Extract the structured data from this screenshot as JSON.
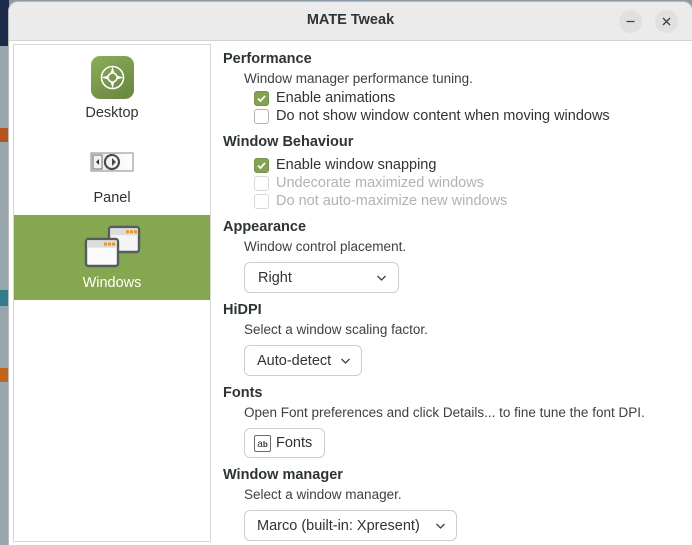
{
  "window": {
    "title": "MATE Tweak",
    "controls": {
      "minimize_label": "–",
      "close_label": "×"
    }
  },
  "sidebar": {
    "items": [
      {
        "label": "Desktop",
        "icon": "desktop-compass-icon",
        "selected": false
      },
      {
        "label": "Panel",
        "icon": "panel-icon",
        "selected": false
      },
      {
        "label": "Windows",
        "icon": "windows-stack-icon",
        "selected": true
      }
    ]
  },
  "sections": {
    "performance": {
      "title": "Performance",
      "description": "Window manager performance tuning.",
      "checkboxes": [
        {
          "label": "Enable animations",
          "checked": true,
          "enabled": true
        },
        {
          "label": "Do not show window content when moving windows",
          "checked": false,
          "enabled": true
        }
      ]
    },
    "window_behaviour": {
      "title": "Window Behaviour",
      "checkboxes": [
        {
          "label": "Enable window snapping",
          "checked": true,
          "enabled": true
        },
        {
          "label": "Undecorate maximized windows",
          "checked": false,
          "enabled": false
        },
        {
          "label": "Do not auto-maximize new windows",
          "checked": false,
          "enabled": false
        }
      ]
    },
    "appearance": {
      "title": "Appearance",
      "description": "Window control placement.",
      "placement_value": "Right"
    },
    "hidpi": {
      "title": "HiDPI",
      "description": "Select a window scaling factor.",
      "scaling_value": "Auto-detect"
    },
    "fonts": {
      "title": "Fonts",
      "description": "Open Font preferences and click Details... to fine tune the font DPI.",
      "button_label": "Fonts",
      "button_icon": "font-ab-icon"
    },
    "window_manager": {
      "title": "Window manager",
      "description": "Select a window manager.",
      "wm_value": "Marco (built-in: Xpresent)"
    }
  },
  "colors": {
    "selection_green": "#84a74f",
    "checkbox_green": "#82a352",
    "titlebar": "#ebebeb",
    "text": "#2e3436",
    "disabled_text": "#b0b3b3"
  }
}
